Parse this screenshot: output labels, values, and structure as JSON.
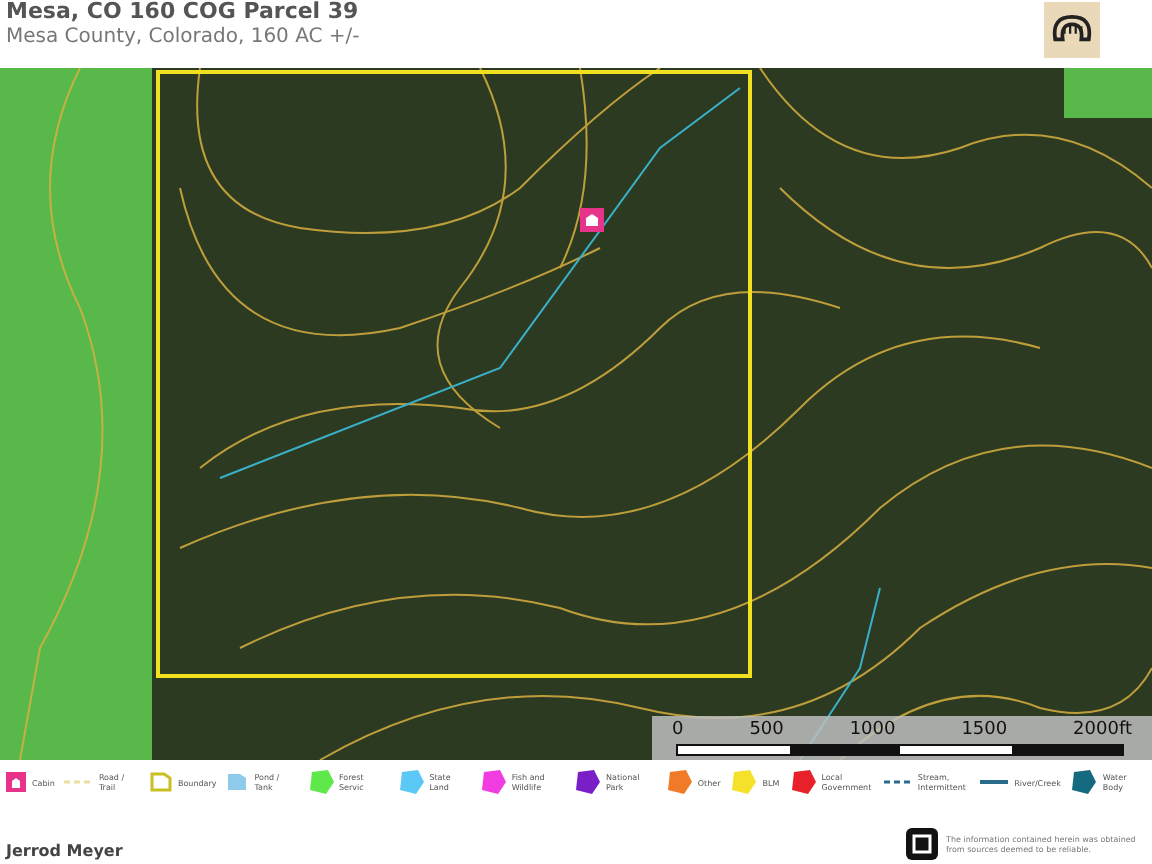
{
  "header": {
    "title": "Mesa, CO 160 COG Parcel 39",
    "subtitle": "Mesa County, Colorado, 160 AC +/-"
  },
  "map": {
    "scale_labels": [
      "0",
      "500",
      "1000",
      "1500",
      "2000ft"
    ]
  },
  "legend": [
    {
      "kind": "cabin",
      "label": "Cabin",
      "color": "#e8338a"
    },
    {
      "kind": "dashed",
      "label": "Road / Trail",
      "color": "#e8e0a0"
    },
    {
      "kind": "outline",
      "label": "Boundary",
      "color": "#c8c020"
    },
    {
      "kind": "pond",
      "label": "Pond / Tank",
      "color": "#8ecbea"
    },
    {
      "kind": "area",
      "label": "Forest Servic",
      "color": "#5ee84a"
    },
    {
      "kind": "area",
      "label": "State Land",
      "color": "#5bc8f5"
    },
    {
      "kind": "area",
      "label": "Fish and Wildlife",
      "color": "#f03ce0"
    },
    {
      "kind": "area",
      "label": "National Park",
      "color": "#7a1ec8"
    },
    {
      "kind": "area",
      "label": "Other",
      "color": "#f07a28"
    },
    {
      "kind": "area",
      "label": "BLM",
      "color": "#f5e02a"
    },
    {
      "kind": "area",
      "label": "Local Government",
      "color": "#e8202a"
    },
    {
      "kind": "dashed",
      "label": "Stream, Intermittent",
      "color": "#2a6a8a"
    },
    {
      "kind": "line",
      "label": "River/Creek",
      "color": "#2a6a8a"
    },
    {
      "kind": "area",
      "label": "Water Body",
      "color": "#156a80"
    }
  ],
  "footer": {
    "agent": "Jerrod Meyer",
    "disclaimer": "The information contained herein was obtained from sources deemed to be reliable."
  }
}
